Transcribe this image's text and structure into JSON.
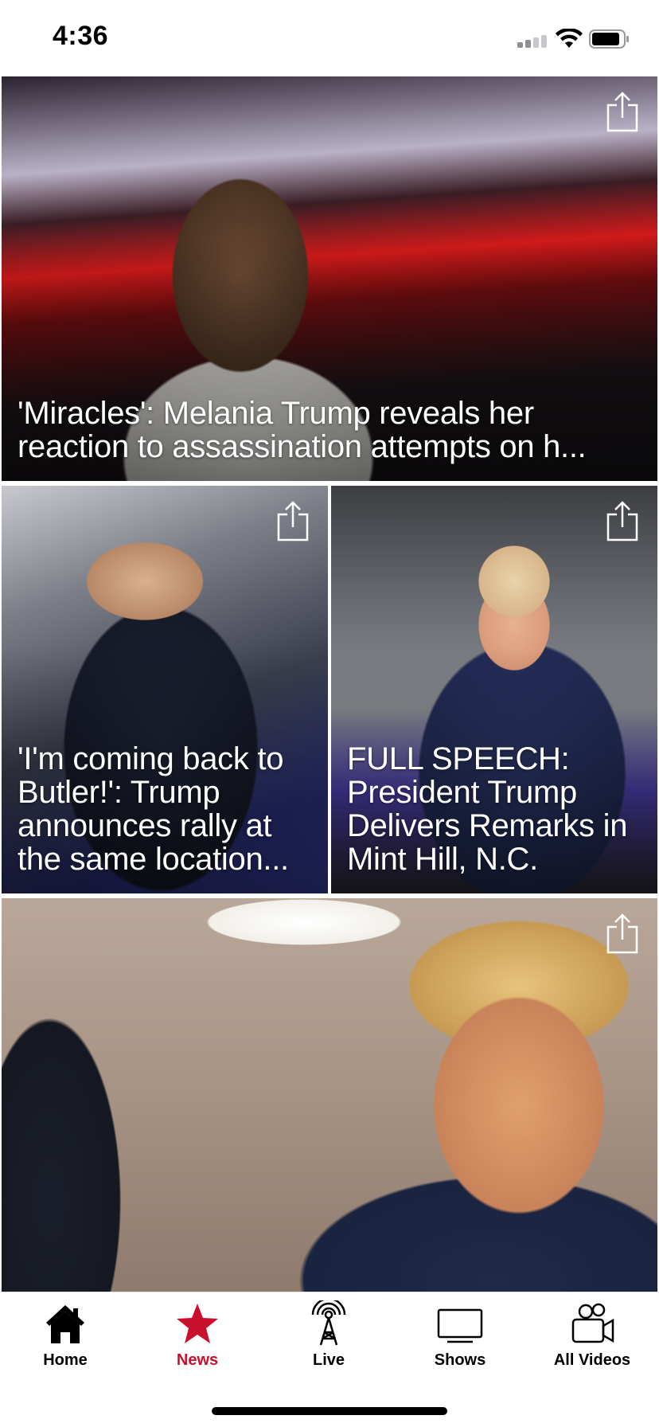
{
  "status_bar": {
    "time": "4:36",
    "signal_icon": "cellular-signal-icon",
    "wifi_icon": "wifi-icon",
    "battery_icon": "battery-icon",
    "battery_level": 0.85
  },
  "feed": {
    "share_icon": "share-icon",
    "items": [
      {
        "headline": "'Miracles': Melania Trump reveals her reaction to assassination attempts on h..."
      },
      {
        "headline": "'I'm coming back to Butler!': Trump announces rally at the same location..."
      },
      {
        "headline": "FULL SPEECH: President Trump Delivers Remarks in Mint Hill, N.C."
      },
      {
        "headline": ""
      }
    ]
  },
  "tab_bar": {
    "active_color": "#c8102e",
    "tabs": [
      {
        "label": "Home",
        "icon": "home-icon"
      },
      {
        "label": "News",
        "icon": "star-icon"
      },
      {
        "label": "Live",
        "icon": "broadcast-tower-icon"
      },
      {
        "label": "Shows",
        "icon": "tv-icon"
      },
      {
        "label": "All Videos",
        "icon": "video-camera-icon"
      }
    ]
  }
}
